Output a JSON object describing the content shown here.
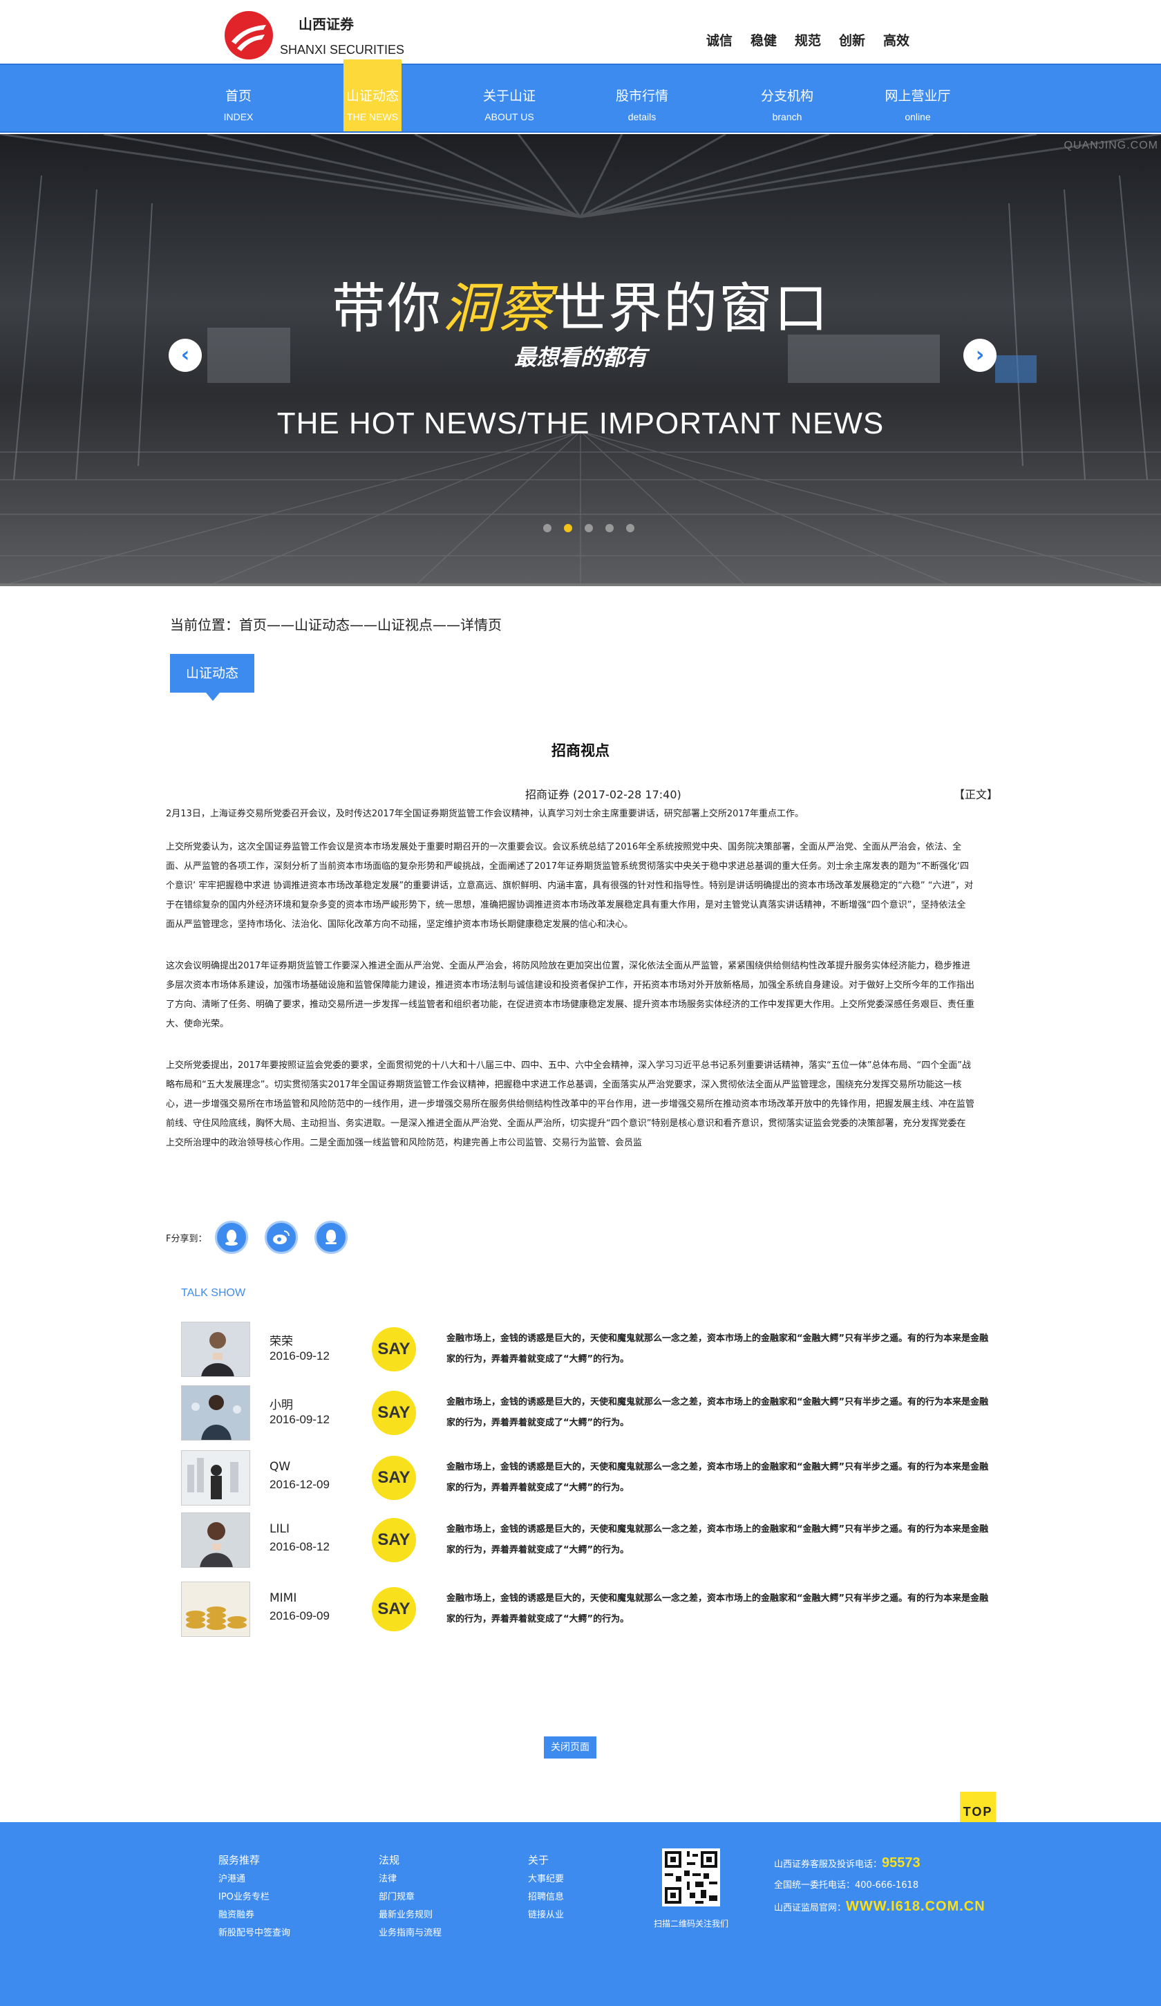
{
  "brand": {
    "name_cn": "山西证券",
    "name_en": "SHANXI SECURITIES"
  },
  "slogans": [
    "诚信",
    "稳健",
    "规范",
    "创新",
    "高效"
  ],
  "nav": [
    {
      "cn": "首页",
      "en": "INDEX"
    },
    {
      "cn": "山证动态",
      "en": "THE NEWS",
      "active": true
    },
    {
      "cn": "关于山证",
      "en": "ABOUT US"
    },
    {
      "cn": "股市行情",
      "en": "details"
    },
    {
      "cn": "分支机构",
      "en": "branch"
    },
    {
      "cn": "网上营业厅",
      "en": "online"
    }
  ],
  "banner": {
    "title_pre": "带你",
    "title_highlight": "洞察",
    "title_post": "世界的窗口",
    "subtitle": "最想看的都有",
    "english": "THE HOT NEWS/THE IMPORTANT NEWS",
    "watermark": "QUANJING.COM",
    "slide_count": 5,
    "active_slide": 2
  },
  "breadcrumb": "当前位置：首页——山证动态——山证视点——详情页",
  "section_tab": "山证动态",
  "article": {
    "title": "招商视点",
    "meta": "招商证券 (2017-02-28 17:40)",
    "tag": "【正文】",
    "paragraphs": [
      "2月13日，上海证券交易所党委召开会议，及时传达2017年全国证券期货监管工作会议精神，认真学习刘士余主席重要讲话，研究部署上交所2017年重点工作。",
      "上交所党委认为，这次全国证券监管工作会议是资本市场发展处于重要时期召开的一次重要会议。会议系统总结了2016年全系统按照党中央、国务院决策部署，全面从严治党、全面从严治会，依法、全面、从严监管的各项工作，深刻分析了当前资本市场面临的复杂形势和严峻挑战，全面阐述了2017年证券期货监管系统贯彻落实中央关于稳中求进总基调的重大任务。刘士余主席发表的题为“不断强化‘四个意识’ 牢牢把握稳中求进 协调推进资本市场改革稳定发展”的重要讲话，立意高远、旗帜鲜明、内涵丰富，具有很强的针对性和指导性。特别是讲话明确提出的资本市场改革发展稳定的“六稳” “六进”，对于在错综复杂的国内外经济环境和复杂多变的资本市场严峻形势下，统一思想，准确把握协调推进资本市场改革发展稳定具有重大作用，是对主管党认真落实讲话精神，不断增强“四个意识”，坚持依法全面从严监管理念，坚持市场化、法治化、国际化改革方向不动摇，坚定维护资本市场长期健康稳定发展的信心和决心。",
      "这次会议明确提出2017年证券期货监管工作要深入推进全面从严治党、全面从严治会，将防风险放在更加突出位置，深化依法全面从严监管，紧紧围绕供给侧结构性改革提升服务实体经济能力，稳步推进多层次资本市场体系建设，加强市场基础设施和监管保障能力建设，推进资本市场法制与诚信建设和投资者保护工作，开拓资本市场对外开放新格局，加强全系统自身建设。对于做好上交所今年的工作指出了方向、清晰了任务、明确了要求，推动交易所进一步发挥一线监管者和组织者功能，在促进资本市场健康稳定发展、提升资本市场服务实体经济的工作中发挥更大作用。上交所党委深感任务艰巨、责任重大、使命光荣。",
      "上交所党委提出，2017年要按照证监会党委的要求，全面贯彻党的十八大和十八届三中、四中、五中、六中全会精神，深入学习习近平总书记系列重要讲话精神，落实“五位一体”总体布局、“四个全面”战略布局和“五大发展理念”。切实贯彻落实2017年全国证券期货监管工作会议精神，把握稳中求进工作总基调，全面落实从严治党要求，深入贯彻依法全面从严监管理念，围绕充分发挥交易所功能这一核心，进一步增强交易所在市场监管和风险防范中的一线作用，进一步增强交易所在服务供给侧结构性改革中的平台作用，进一步增强交易所在推动资本市场改革开放中的先锋作用，把握发展主线、冲在监管前线、守住风险底线，胸怀大局、主动担当、务实进取。一是深入推进全面从严治党、全面从严治所，切实提升“四个意识”特别是核心意识和看齐意识，贯彻落实证监会党委的决策部署，充分发挥党委在上交所治理中的政治领导核心作用。二是全面加强一线监管和风险防范，构建完善上市公司监管、交易行为监管、会员监"
    ]
  },
  "share": {
    "label": "F分享到：",
    "targets": [
      "qq-icon",
      "weibo-icon",
      "qzone-icon"
    ]
  },
  "talk_show": {
    "heading": "TALK SHOW",
    "say_label": "SAY",
    "items": [
      {
        "name": "荣荣",
        "date": "2016-09-12",
        "text": "金融市场上，金钱的诱惑是巨大的，天使和魔鬼就那么一念之差，资本市场上的金融家和“金融大鳄”只有半步之遥。有的行为本来是金融家的行为，弄着弄着就变成了“大鳄”的行为。"
      },
      {
        "name": "小明",
        "date": "2016-09-12",
        "text": "金融市场上，金钱的诱惑是巨大的，天使和魔鬼就那么一念之差，资本市场上的金融家和“金融大鳄”只有半步之遥。有的行为本来是金融家的行为，弄着弄着就变成了“大鳄”的行为。"
      },
      {
        "name": "QW",
        "date": "2016-12-09",
        "text": "金融市场上，金钱的诱惑是巨大的，天使和魔鬼就那么一念之差，资本市场上的金融家和“金融大鳄”只有半步之遥。有的行为本来是金融家的行为，弄着弄着就变成了“大鳄”的行为。"
      },
      {
        "name": "LILI",
        "date": "2016-08-12",
        "text": "金融市场上，金钱的诱惑是巨大的，天使和魔鬼就那么一念之差，资本市场上的金融家和“金融大鳄”只有半步之遥。有的行为本来是金融家的行为，弄着弄着就变成了“大鳄”的行为。"
      },
      {
        "name": "MIMI",
        "date": "2016-09-09",
        "text": "金融市场上，金钱的诱惑是巨大的，天使和魔鬼就那么一念之差，资本市场上的金融家和“金融大鳄”只有半步之遥。有的行为本来是金融家的行为，弄着弄着就变成了“大鳄”的行为。"
      }
    ]
  },
  "close_button": "关闭页面",
  "top_button": "TOP",
  "footer": {
    "columns": [
      {
        "head": "服务推荐",
        "links": [
          "沪港通",
          "IPO业务专栏",
          "融资融券",
          "新股配号中签查询"
        ]
      },
      {
        "head": "法规",
        "links": [
          "法律",
          "部门规章",
          "最新业务规则",
          "业务指南与流程"
        ]
      },
      {
        "head": "关于",
        "links": [
          "大事纪要",
          "招聘信息",
          "链接从业"
        ]
      }
    ],
    "qr_caption": "扫描二维码关注我们",
    "contact": {
      "hotline_label": "山西证券客服及投诉电话：",
      "hotline": "95573",
      "national": "全国统一委托电话：400-666-1618",
      "site_label": "山西证监局官网：",
      "site": "WWW.I618.COM.CN"
    }
  },
  "colors": {
    "primary": "#3e8bef",
    "accent": "#fdd93a",
    "say": "#f8e11c",
    "logo": "#e1242a"
  }
}
